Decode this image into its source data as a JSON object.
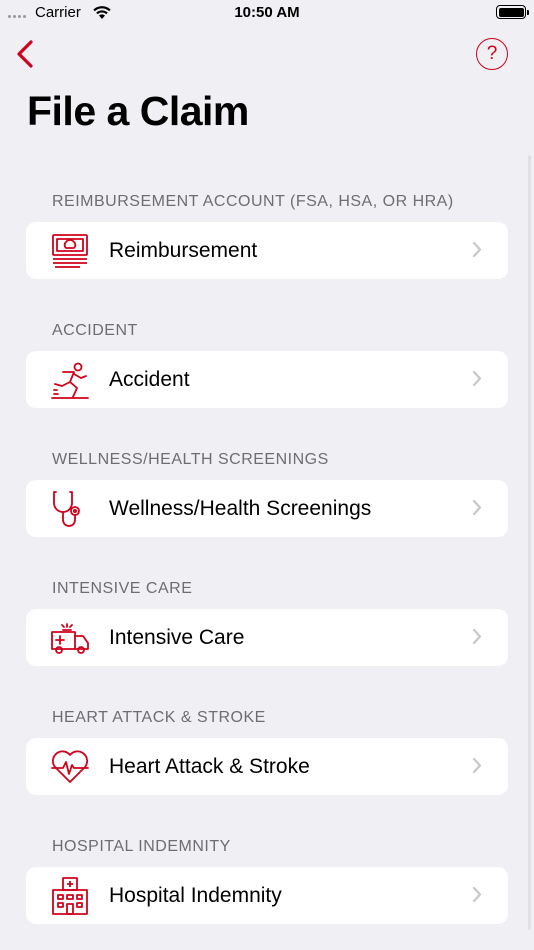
{
  "status_bar": {
    "carrier": "Carrier",
    "time": "10:50 AM"
  },
  "header": {
    "title": "File a Claim",
    "help_label": "?"
  },
  "colors": {
    "accent": "#d0021b",
    "background": "#efeff4",
    "section_header": "#6d6d72",
    "chevron": "#c7c7cc"
  },
  "sections": [
    {
      "header": "REIMBURSEMENT ACCOUNT (FSA, HSA, OR HRA)",
      "label": "Reimbursement",
      "icon": "money-stack-icon"
    },
    {
      "header": "ACCIDENT",
      "label": "Accident",
      "icon": "slip-fall-icon"
    },
    {
      "header": "WELLNESS/HEALTH SCREENINGS",
      "label": "Wellness/Health Screenings",
      "icon": "stethoscope-icon"
    },
    {
      "header": "INTENSIVE CARE",
      "label": "Intensive Care",
      "icon": "ambulance-icon"
    },
    {
      "header": "HEART ATTACK & STROKE",
      "label": "Heart Attack & Stroke",
      "icon": "heartbeat-icon"
    },
    {
      "header": "HOSPITAL INDEMNITY",
      "label": "Hospital Indemnity",
      "icon": "hospital-icon"
    }
  ]
}
